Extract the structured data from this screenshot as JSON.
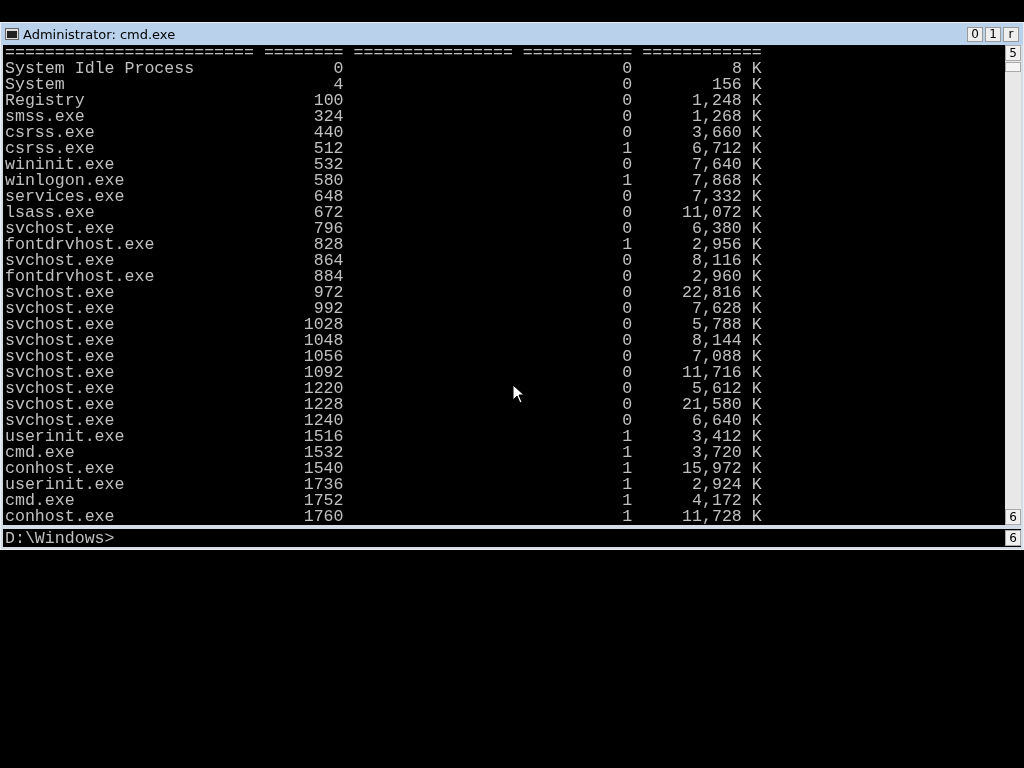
{
  "window": {
    "title": "Administrator: cmd.exe",
    "buttons": [
      "0",
      "1",
      "r"
    ]
  },
  "console": {
    "separator": "========================= ======== ================ =========== ============",
    "rows": [
      {
        "name": "System Idle Process",
        "pid": "0",
        "session": "0",
        "mem": "8 K"
      },
      {
        "name": "System",
        "pid": "4",
        "session": "0",
        "mem": "156 K"
      },
      {
        "name": "Registry",
        "pid": "100",
        "session": "0",
        "mem": "1,248 K"
      },
      {
        "name": "smss.exe",
        "pid": "324",
        "session": "0",
        "mem": "1,268 K"
      },
      {
        "name": "csrss.exe",
        "pid": "440",
        "session": "0",
        "mem": "3,660 K"
      },
      {
        "name": "csrss.exe",
        "pid": "512",
        "session": "1",
        "mem": "6,712 K"
      },
      {
        "name": "wininit.exe",
        "pid": "532",
        "session": "0",
        "mem": "7,640 K"
      },
      {
        "name": "winlogon.exe",
        "pid": "580",
        "session": "1",
        "mem": "7,868 K"
      },
      {
        "name": "services.exe",
        "pid": "648",
        "session": "0",
        "mem": "7,332 K"
      },
      {
        "name": "lsass.exe",
        "pid": "672",
        "session": "0",
        "mem": "11,072 K"
      },
      {
        "name": "svchost.exe",
        "pid": "796",
        "session": "0",
        "mem": "6,380 K"
      },
      {
        "name": "fontdrvhost.exe",
        "pid": "828",
        "session": "1",
        "mem": "2,956 K"
      },
      {
        "name": "svchost.exe",
        "pid": "864",
        "session": "0",
        "mem": "8,116 K"
      },
      {
        "name": "fontdrvhost.exe",
        "pid": "884",
        "session": "0",
        "mem": "2,960 K"
      },
      {
        "name": "svchost.exe",
        "pid": "972",
        "session": "0",
        "mem": "22,816 K"
      },
      {
        "name": "svchost.exe",
        "pid": "992",
        "session": "0",
        "mem": "7,628 K"
      },
      {
        "name": "svchost.exe",
        "pid": "1028",
        "session": "0",
        "mem": "5,788 K"
      },
      {
        "name": "svchost.exe",
        "pid": "1048",
        "session": "0",
        "mem": "8,144 K"
      },
      {
        "name": "svchost.exe",
        "pid": "1056",
        "session": "0",
        "mem": "7,088 K"
      },
      {
        "name": "svchost.exe",
        "pid": "1092",
        "session": "0",
        "mem": "11,716 K"
      },
      {
        "name": "svchost.exe",
        "pid": "1220",
        "session": "0",
        "mem": "5,612 K"
      },
      {
        "name": "svchost.exe",
        "pid": "1228",
        "session": "0",
        "mem": "21,580 K"
      },
      {
        "name": "svchost.exe",
        "pid": "1240",
        "session": "0",
        "mem": "6,640 K"
      },
      {
        "name": "userinit.exe",
        "pid": "1516",
        "session": "1",
        "mem": "3,412 K"
      },
      {
        "name": "cmd.exe",
        "pid": "1532",
        "session": "1",
        "mem": "3,720 K"
      },
      {
        "name": "conhost.exe",
        "pid": "1540",
        "session": "1",
        "mem": "15,972 K"
      },
      {
        "name": "userinit.exe",
        "pid": "1736",
        "session": "1",
        "mem": "2,924 K"
      },
      {
        "name": "cmd.exe",
        "pid": "1752",
        "session": "1",
        "mem": "4,172 K"
      },
      {
        "name": "conhost.exe",
        "pid": "1760",
        "session": "1",
        "mem": "11,728 K"
      }
    ],
    "scroll_up": "5",
    "scroll_down": "6"
  },
  "input": {
    "prompt": "D:\\Windows>",
    "scroll_button": "6"
  }
}
